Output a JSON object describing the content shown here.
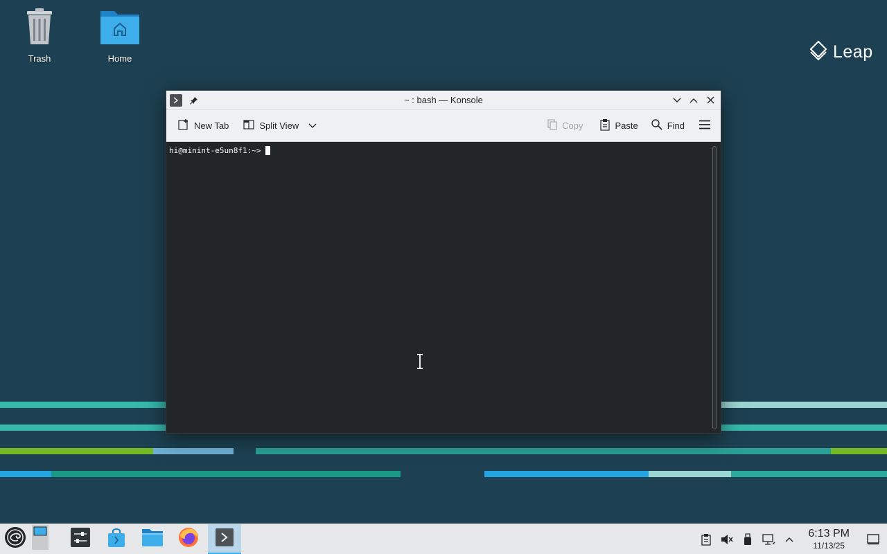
{
  "desktop": {
    "icons": [
      {
        "label": "Trash"
      },
      {
        "label": "Home"
      }
    ],
    "brand": "Leap",
    "colors": {
      "background": "#1d4152",
      "stripe_teal": "#35b9ab",
      "stripe_green": "#73ba25",
      "stripe_blue": "#21a4df"
    }
  },
  "window": {
    "title": "~ : bash — Konsole",
    "icons": {
      "app": "konsole-icon",
      "pin": "pin-icon"
    },
    "controls": [
      "minimize-icon",
      "maximize-icon",
      "close-icon"
    ],
    "toolbar": {
      "new_tab": "New Tab",
      "split_view": "Split View",
      "copy": "Copy",
      "paste": "Paste",
      "find": "Find"
    },
    "terminal": {
      "prompt": "hi@minint-e5un8f1:~>"
    }
  },
  "taskbar": {
    "items": [
      "application-launcher",
      "desktop-pager",
      "system-settings",
      "software-store",
      "file-manager",
      "firefox",
      "konsole"
    ],
    "active": "konsole",
    "tray": [
      "clipboard-icon",
      "volume-muted-icon",
      "usb-device-icon",
      "network-icon",
      "chevron-up-icon"
    ],
    "clock": {
      "time": "6:13 PM",
      "date": "11/13/25"
    }
  }
}
